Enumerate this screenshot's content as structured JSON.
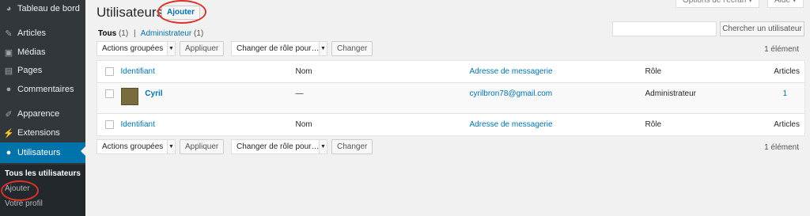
{
  "sidebar": {
    "items": [
      {
        "label": "Tableau de bord",
        "icon": "dashboard-icon",
        "glyph": "◕"
      },
      {
        "label": "Articles",
        "icon": "pin-icon",
        "glyph": "✎"
      },
      {
        "label": "Médias",
        "icon": "media-icon",
        "glyph": "▣"
      },
      {
        "label": "Pages",
        "icon": "pages-icon",
        "glyph": "▤"
      },
      {
        "label": "Commentaires",
        "icon": "comments-icon",
        "glyph": "●"
      },
      {
        "label": "Apparence",
        "icon": "appearance-icon",
        "glyph": "✐"
      },
      {
        "label": "Extensions",
        "icon": "plugins-icon",
        "glyph": "⚡"
      },
      {
        "label": "Utilisateurs",
        "icon": "users-icon",
        "glyph": "●"
      }
    ],
    "submenu": [
      "Tous les utilisateurs",
      "Ajouter",
      "Votre profil"
    ]
  },
  "header": {
    "title": "Utilisateurs",
    "add_label": "Ajouter",
    "screen_options": "Options de l'écran ▾",
    "help": "Aide ▾"
  },
  "filters": {
    "all_label": "Tous",
    "all_count": "(1)",
    "separator": "|",
    "admin_label": "Administrateur",
    "admin_count": "(1)"
  },
  "search": {
    "button": "Chercher un utilisateur",
    "value": ""
  },
  "tablenav": {
    "bulk_actions": "Actions groupées",
    "apply": "Appliquer",
    "change_role": "Changer de rôle pour…",
    "change": "Changer",
    "count": "1 élément"
  },
  "table": {
    "columns": [
      "Identifiant",
      "Nom",
      "Adresse de messagerie",
      "Rôle",
      "Articles"
    ],
    "rows": [
      {
        "username": "Cyril",
        "name": "—",
        "email": "cyrilbron78@gmail.com",
        "role": "Administrateur",
        "posts": "1"
      }
    ]
  },
  "colors": {
    "sidebar": "#32373c",
    "accent": "#0073aa",
    "highlight": "#d9332b"
  }
}
